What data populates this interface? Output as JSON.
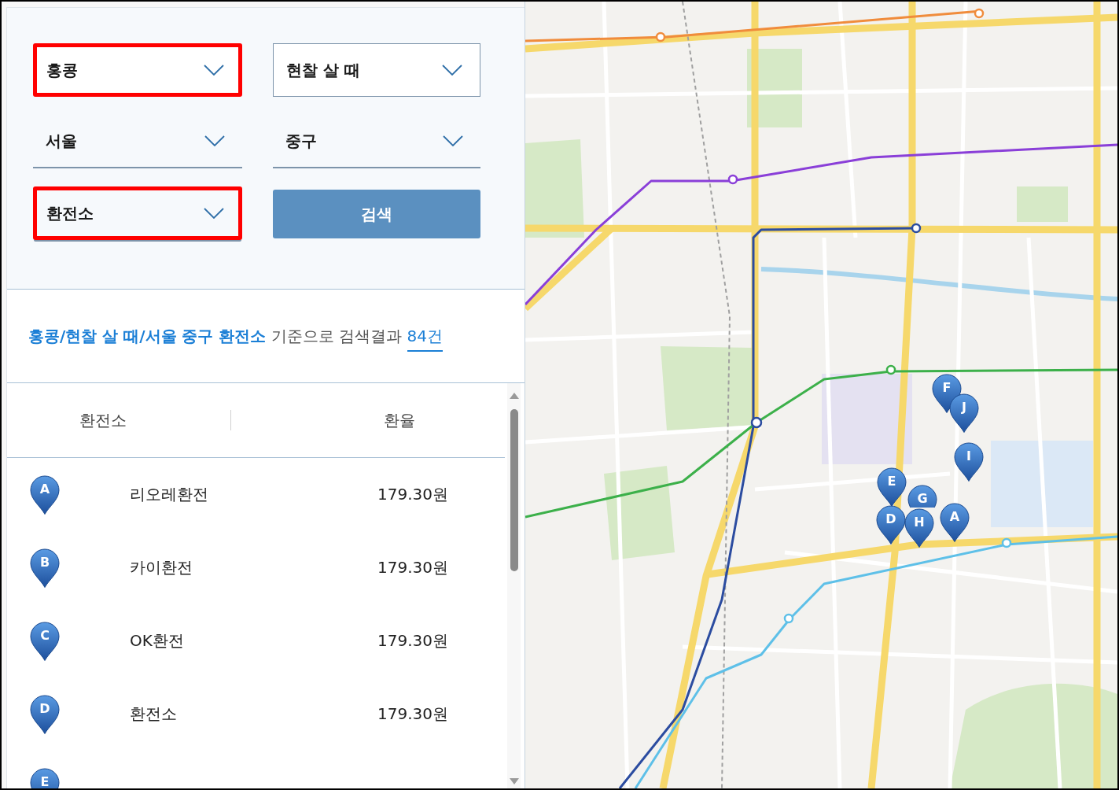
{
  "filters": [
    {
      "kind": "boxed",
      "value": "홍콩",
      "highlighted": true
    },
    {
      "kind": "boxed",
      "value": "현찰 살 때",
      "highlighted": false
    },
    {
      "kind": "underlined",
      "value": "서울",
      "highlighted": false
    },
    {
      "kind": "underlined",
      "value": "중구",
      "highlighted": false
    },
    {
      "kind": "underlined",
      "value": "환전소",
      "highlighted": true
    }
  ],
  "search_button": {
    "label": "검색"
  },
  "summary": {
    "query": "홍콩/현찰 살 때/서울 중구 환전소",
    "text": "기준으로 검색결과",
    "count": "84건"
  },
  "table": {
    "columns": [
      "환전소",
      "환율"
    ],
    "rows": [
      {
        "marker": "A",
        "name": "리오레환전",
        "rate": "179.30원"
      },
      {
        "marker": "B",
        "name": "카이환전",
        "rate": "179.30원"
      },
      {
        "marker": "C",
        "name": "OK환전",
        "rate": "179.30원"
      },
      {
        "marker": "D",
        "name": "환전소",
        "rate": "179.30원"
      },
      {
        "marker": "E"
      }
    ]
  },
  "map": {
    "pins": [
      {
        "label": "F"
      },
      {
        "label": "J"
      },
      {
        "label": "I"
      },
      {
        "label": "E"
      },
      {
        "label": "G"
      },
      {
        "label": "D"
      },
      {
        "label": "H"
      },
      {
        "label": "A"
      }
    ]
  }
}
